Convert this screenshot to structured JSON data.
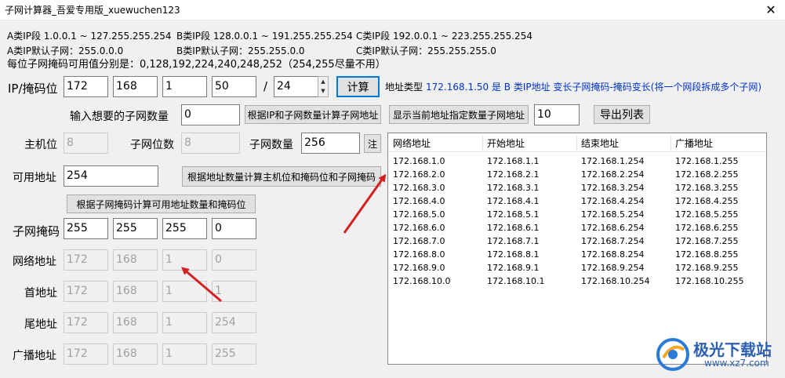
{
  "window": {
    "title": "子网计算器_吾爱专用版_xuewuchen123",
    "close_glyph": "✕"
  },
  "info": {
    "a_range": "A类IP段 1.0.0.1 ~ 127.255.255.254",
    "b_range": "B类IP段 128.0.0.1 ~ 191.255.255.254",
    "c_range": "C类IP段 192.0.0.1 ~ 223.255.255.254",
    "a_default": "A类IP默认子网：255.0.0.0",
    "b_default": "B类IP默认子网：255.255.0.0",
    "c_default": "C类IP默认子网：255.255.255.0",
    "mask_values": "每位子网掩码可用值分别是：0,128,192,224,240,248,252（254,255尽量不用）"
  },
  "ip_row": {
    "label": "IP/掩码位",
    "octets": [
      "172",
      "168",
      "1",
      "50"
    ],
    "slash": "/",
    "mask_bits": "24",
    "spin_up": "▲",
    "spin_down": "▼",
    "calc_button": "计算",
    "addr_type_label": "地址类型",
    "addr_type_value": "172.168.1.50  是 B 类IP地址  变长子网掩码-掩码变长(将一个网段拆成多个子网)"
  },
  "subnet_count_row": {
    "label": "输入想要的子网数量",
    "value": "0",
    "calc_by_ip_button": "根据IP和子网数量计算子网地址",
    "show_button": "显示当前地址指定数量子网地址",
    "show_count": "10",
    "export_button": "导出列表"
  },
  "host_row": {
    "host_bits_label": "主机位",
    "host_bits_value": "8",
    "subnet_bits_label": "子网位数",
    "subnet_bits_value": "8",
    "subnet_count_label": "子网数量",
    "subnet_count_value": "256",
    "note_button": "注"
  },
  "usable_row": {
    "label": "可用地址",
    "value": "254",
    "calc_by_count_button": "根据地址数量计算主机位和掩码位和子网掩码"
  },
  "calc_by_mask_button": "根据子网掩码计算可用地址数量和掩码位",
  "mask_row": {
    "label": "子网掩码",
    "values": [
      "255",
      "255",
      "255",
      "0"
    ]
  },
  "network_row": {
    "label": "网络地址",
    "values": [
      "172",
      "168",
      "1",
      "0"
    ]
  },
  "first_row": {
    "label": "首地址",
    "values": [
      "172",
      "168",
      "1",
      "1"
    ]
  },
  "last_row": {
    "label": "尾地址",
    "values": [
      "172",
      "168",
      "1",
      "254"
    ]
  },
  "broadcast_row": {
    "label": "广播地址",
    "values": [
      "172",
      "168",
      "1",
      "255"
    ]
  },
  "table": {
    "headers": [
      "网络地址",
      "开始地址",
      "结束地址",
      "广播地址"
    ],
    "rows": [
      [
        "172.168.1.0",
        "172.168.1.1",
        "172.168.1.254",
        "172.168.1.255"
      ],
      [
        "172.168.2.0",
        "172.168.2.1",
        "172.168.2.254",
        "172.168.2.255"
      ],
      [
        "172.168.3.0",
        "172.168.3.1",
        "172.168.3.254",
        "172.168.3.255"
      ],
      [
        "172.168.4.0",
        "172.168.4.1",
        "172.168.4.254",
        "172.168.4.255"
      ],
      [
        "172.168.5.0",
        "172.168.5.1",
        "172.168.5.254",
        "172.168.5.255"
      ],
      [
        "172.168.6.0",
        "172.168.6.1",
        "172.168.6.254",
        "172.168.6.255"
      ],
      [
        "172.168.7.0",
        "172.168.7.1",
        "172.168.7.254",
        "172.168.7.255"
      ],
      [
        "172.168.8.0",
        "172.168.8.1",
        "172.168.8.254",
        "172.168.8.255"
      ],
      [
        "172.168.9.0",
        "172.168.9.1",
        "172.168.9.254",
        "172.168.9.255"
      ],
      [
        "172.168.10.0",
        "172.168.10.1",
        "172.168.10.254",
        "172.168.10.255"
      ]
    ]
  },
  "watermark": {
    "text": "极光下载站",
    "url": "www.xz7.com"
  },
  "colors": {
    "accent": "#0033cc",
    "arrow": "#d42020",
    "button_face": "#e1e1e1"
  }
}
